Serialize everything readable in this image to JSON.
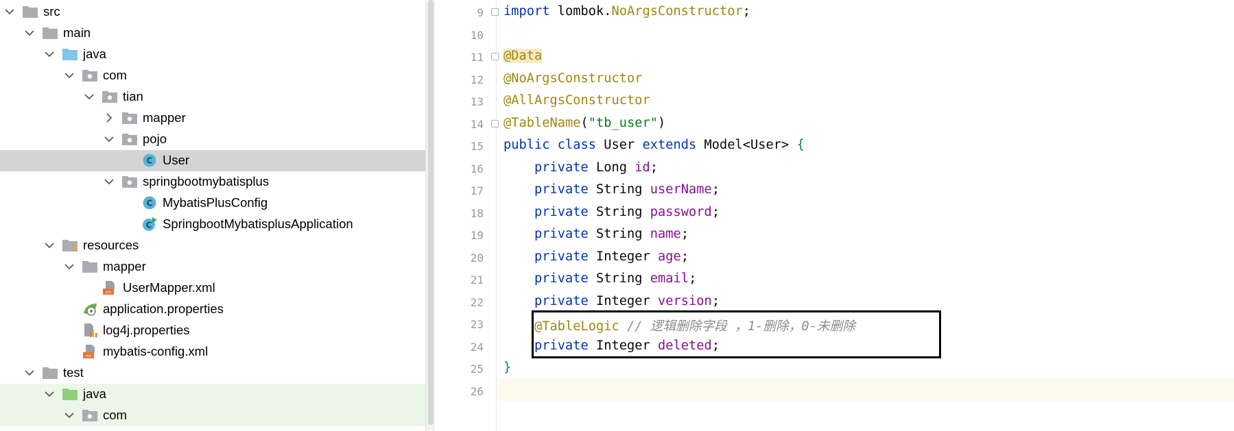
{
  "tree": [
    {
      "label": "src",
      "icon": "folder-gray",
      "chevron": "down",
      "depth": 0
    },
    {
      "label": "main",
      "icon": "folder-gray",
      "chevron": "down",
      "depth": 1
    },
    {
      "label": "java",
      "icon": "folder-blue",
      "chevron": "down",
      "depth": 2
    },
    {
      "label": "com",
      "icon": "package",
      "chevron": "down",
      "depth": 3
    },
    {
      "label": "tian",
      "icon": "package",
      "chevron": "down",
      "depth": 4
    },
    {
      "label": "mapper",
      "icon": "package",
      "chevron": "right",
      "depth": 5
    },
    {
      "label": "pojo",
      "icon": "package",
      "chevron": "down",
      "depth": 5
    },
    {
      "label": "User",
      "icon": "class",
      "chevron": "none",
      "depth": 6,
      "selected": true
    },
    {
      "label": "springbootmybatisplus",
      "icon": "package",
      "chevron": "down",
      "depth": 5
    },
    {
      "label": "MybatisPlusConfig",
      "icon": "class",
      "chevron": "none",
      "depth": 6
    },
    {
      "label": "SpringbootMybatisplusApplication",
      "icon": "spring-class",
      "chevron": "none",
      "depth": 6
    },
    {
      "label": "resources",
      "icon": "resources-folder",
      "chevron": "down",
      "depth": 2
    },
    {
      "label": "mapper",
      "icon": "folder-gray",
      "chevron": "down",
      "depth": 3
    },
    {
      "label": "UserMapper.xml",
      "icon": "xml-file",
      "chevron": "none",
      "depth": 4
    },
    {
      "label": "application.properties",
      "icon": "spring-properties",
      "chevron": "none",
      "depth": 3
    },
    {
      "label": "log4j.properties",
      "icon": "properties-file",
      "chevron": "none",
      "depth": 3
    },
    {
      "label": "mybatis-config.xml",
      "icon": "xml-file",
      "chevron": "none",
      "depth": 3
    },
    {
      "label": "test",
      "icon": "folder-gray",
      "chevron": "down",
      "depth": 1
    },
    {
      "label": "java",
      "icon": "folder-green",
      "chevron": "down",
      "depth": 2,
      "test": true
    },
    {
      "label": "com",
      "icon": "package",
      "chevron": "down",
      "depth": 3,
      "test": true
    }
  ],
  "editor": {
    "lines": [
      {
        "n": "9",
        "fold": true,
        "tokens": [
          {
            "t": "import",
            "c": "kw"
          },
          {
            "t": " lombok."
          },
          {
            "t": "NoArgsConstructor",
            "c": "ann"
          },
          {
            "t": ";"
          }
        ]
      },
      {
        "n": "10",
        "tokens": []
      },
      {
        "n": "11",
        "fold": true,
        "tokens": [
          {
            "t": "@Data",
            "c": "ann-hl"
          }
        ]
      },
      {
        "n": "12",
        "tokens": [
          {
            "t": "@NoArgsConstructor",
            "c": "ann"
          }
        ]
      },
      {
        "n": "13",
        "tokens": [
          {
            "t": "@AllArgsConstructor",
            "c": "ann"
          }
        ]
      },
      {
        "n": "14",
        "fold": true,
        "tokens": [
          {
            "t": "@TableName",
            "c": "ann"
          },
          {
            "t": "("
          },
          {
            "t": "\"tb_user\"",
            "c": "str"
          },
          {
            "t": ")"
          }
        ]
      },
      {
        "n": "15",
        "tokens": [
          {
            "t": "public class",
            "c": "kw"
          },
          {
            "t": " User "
          },
          {
            "t": "extends",
            "c": "kw"
          },
          {
            "t": " Model<User> "
          },
          {
            "t": "{",
            "c": "brace"
          }
        ]
      },
      {
        "n": "16",
        "tokens": [
          {
            "t": "    "
          },
          {
            "t": "private",
            "c": "kw"
          },
          {
            "t": " Long "
          },
          {
            "t": "id",
            "c": "fld"
          },
          {
            "t": ";"
          }
        ]
      },
      {
        "n": "17",
        "tokens": [
          {
            "t": "    "
          },
          {
            "t": "private",
            "c": "kw"
          },
          {
            "t": " String "
          },
          {
            "t": "userName",
            "c": "fld"
          },
          {
            "t": ";"
          }
        ]
      },
      {
        "n": "18",
        "tokens": [
          {
            "t": "    "
          },
          {
            "t": "private",
            "c": "kw"
          },
          {
            "t": " String "
          },
          {
            "t": "password",
            "c": "fld"
          },
          {
            "t": ";"
          }
        ]
      },
      {
        "n": "19",
        "tokens": [
          {
            "t": "    "
          },
          {
            "t": "private",
            "c": "kw"
          },
          {
            "t": " String "
          },
          {
            "t": "name",
            "c": "fld"
          },
          {
            "t": ";"
          }
        ]
      },
      {
        "n": "20",
        "tokens": [
          {
            "t": "    "
          },
          {
            "t": "private",
            "c": "kw"
          },
          {
            "t": " Integer "
          },
          {
            "t": "age",
            "c": "fld"
          },
          {
            "t": ";"
          }
        ]
      },
      {
        "n": "21",
        "tokens": [
          {
            "t": "    "
          },
          {
            "t": "private",
            "c": "kw"
          },
          {
            "t": " String "
          },
          {
            "t": "email",
            "c": "fld"
          },
          {
            "t": ";"
          }
        ]
      },
      {
        "n": "22",
        "tokens": [
          {
            "t": "    "
          },
          {
            "t": "private",
            "c": "kw"
          },
          {
            "t": " Integer "
          },
          {
            "t": "version",
            "c": "fld"
          },
          {
            "t": ";"
          }
        ]
      },
      {
        "n": "23",
        "tokens": [
          {
            "t": "    "
          },
          {
            "t": "@TableLogic",
            "c": "ann"
          },
          {
            "t": " "
          },
          {
            "t": "// 逻辑删除字段 ，1-删除，0-未删除",
            "c": "cmt"
          }
        ]
      },
      {
        "n": "24",
        "tokens": [
          {
            "t": "    "
          },
          {
            "t": "private",
            "c": "kw"
          },
          {
            "t": " Integer "
          },
          {
            "t": "deleted",
            "c": "fld"
          },
          {
            "t": ";"
          }
        ]
      },
      {
        "n": "25",
        "tokens": [
          {
            "t": "}",
            "c": "brace"
          }
        ]
      },
      {
        "n": "26",
        "tokens": []
      }
    ]
  }
}
